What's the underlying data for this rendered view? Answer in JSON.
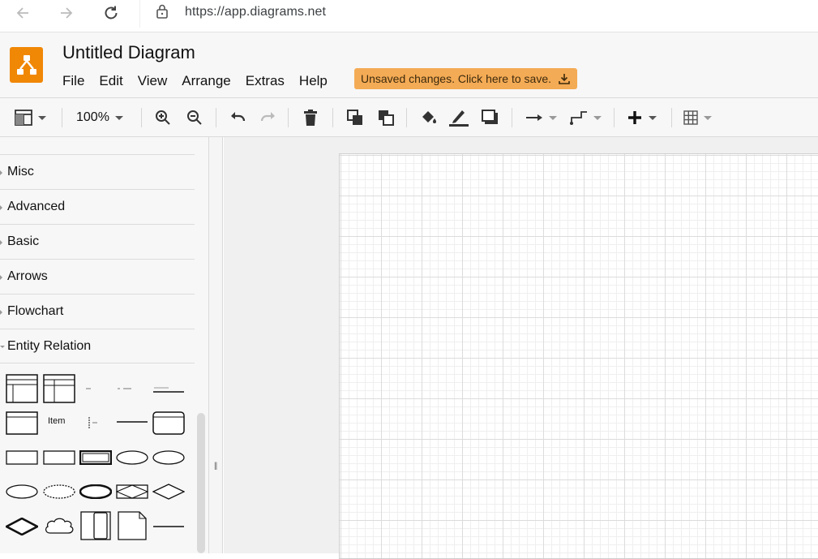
{
  "browser": {
    "url": "https://app.diagrams.net"
  },
  "app": {
    "title": "Untitled Diagram",
    "menu": [
      "File",
      "Edit",
      "View",
      "Arrange",
      "Extras",
      "Help"
    ],
    "unsaved_notice": "Unsaved changes. Click here to save.",
    "accent": "#f08705",
    "notice_color": "#f4ab55"
  },
  "toolbar": {
    "zoom": "100%"
  },
  "sidebar": {
    "sections": [
      {
        "label": "Misc",
        "open": false
      },
      {
        "label": "Advanced",
        "open": false
      },
      {
        "label": "Basic",
        "open": false
      },
      {
        "label": "Arrows",
        "open": false
      },
      {
        "label": "Flowchart",
        "open": false
      },
      {
        "label": "Entity Relation",
        "open": true
      }
    ],
    "shape_texts": {
      "item": "Item",
      "entity": "Entity",
      "attribute": "Attribute",
      "relationship": "Relationship",
      "cloud": "Cloud",
      "note": "Note"
    }
  }
}
